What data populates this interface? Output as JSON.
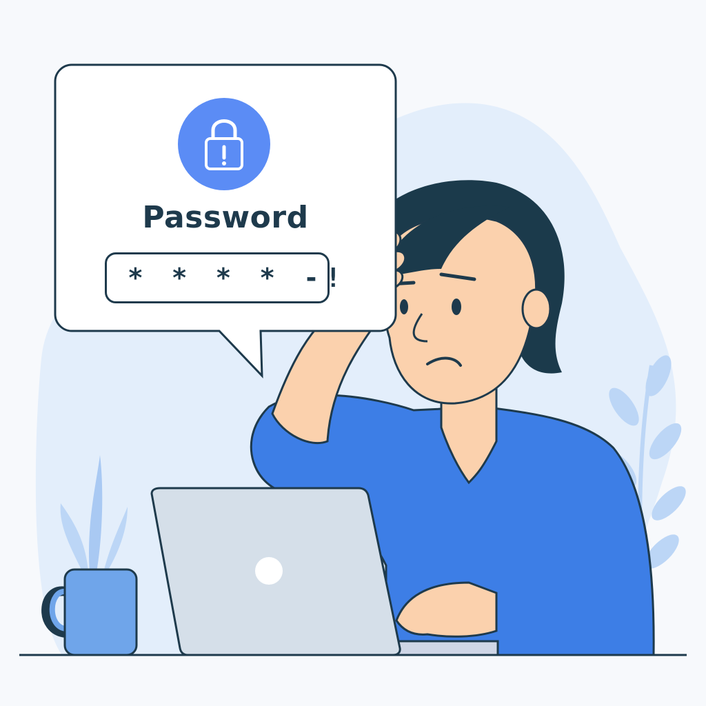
{
  "dialog": {
    "icon": "lock-warning-icon",
    "title": "Password",
    "password_value": "* * * * -!"
  },
  "colors": {
    "accent_blue": "#5b8cf5",
    "shirt_blue": "#3d7ee6",
    "hair_dark": "#1b3a4b",
    "skin": "#fbd1ad",
    "background_blob": "#e3eefb",
    "outline": "#1e3a4c"
  }
}
